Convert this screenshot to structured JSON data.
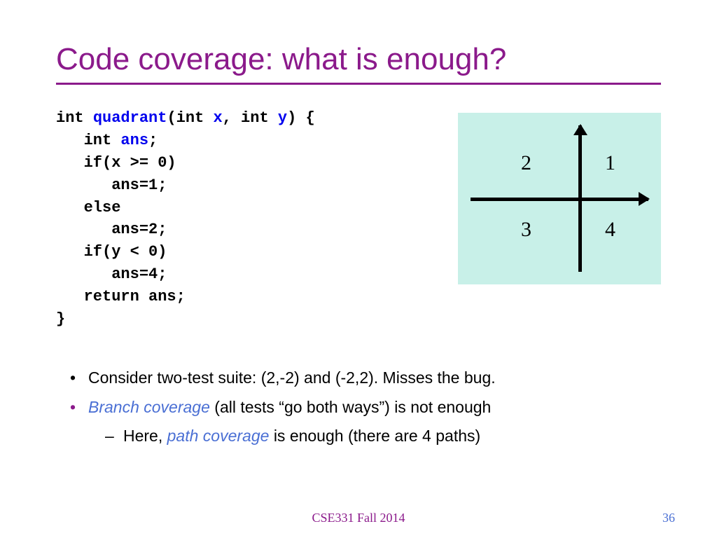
{
  "title": "Code coverage: what is enough?",
  "code": {
    "l1a": "int ",
    "l1b": "quadrant",
    "l1c": "(int ",
    "l1d": "x",
    "l1e": ", int ",
    "l1f": "y",
    "l1g": ") {",
    "l2a": "   int ",
    "l2b": "ans",
    "l2c": ";",
    "l3": "   if(x >= 0)",
    "l4": "      ans=1;",
    "l5": "   else",
    "l6": "      ans=2;",
    "l7": "   if(y < 0)",
    "l8": "      ans=4;",
    "l9": "   return ans;",
    "l10": "}"
  },
  "quad": {
    "q1": "1",
    "q2": "2",
    "q3": "3",
    "q4": "4"
  },
  "bullets": {
    "b1": "Consider two-test suite: (2,-2) and (-2,2).  Misses the bug.",
    "b2a": "Branch coverage ",
    "b2b": "(all tests “go both ways”) is not enough",
    "b3a": "Here, ",
    "b3b": "path coverage ",
    "b3c": "is enough (there are 4 paths)"
  },
  "footer": "CSE331 Fall 2014",
  "page": "36"
}
